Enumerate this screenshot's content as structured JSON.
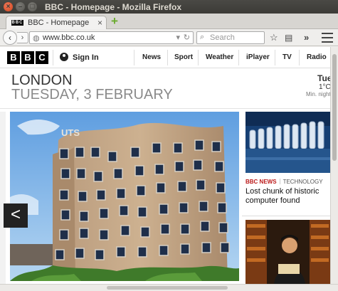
{
  "window": {
    "title": "BBC - Homepage - Mozilla Firefox"
  },
  "tab": {
    "label": "BBC - Homepage",
    "favicon_text": "BBC",
    "close_label": "×"
  },
  "newtab_label": "+",
  "nav": {
    "url": "www.bbc.co.uk",
    "search_placeholder": "Search",
    "back_icon": "‹",
    "forward_icon": "›",
    "reload_icon": "↻",
    "dropdown_icon": "▾"
  },
  "bbc": {
    "logo": [
      "B",
      "B",
      "C"
    ],
    "signin": "Sign In",
    "nav_items": [
      "News",
      "Sport",
      "Weather",
      "iPlayer",
      "TV",
      "Radio"
    ]
  },
  "location": {
    "city": "LONDON",
    "date": "TUESDAY, 3 FEBRUARY"
  },
  "weather": {
    "day": "Tue",
    "temp": "1°C",
    "min": "Min. night"
  },
  "hero": {
    "sign_text": "UTS",
    "prev_label": "<"
  },
  "story1": {
    "tag": "BBC NEWS",
    "topic": "TECHNOLOGY",
    "headline": "Lost chunk of historic computer found"
  },
  "colors": {
    "bbc_red": "#bb1919",
    "firefox_add": "#6aab2e",
    "close_orange": "#e0562b"
  }
}
